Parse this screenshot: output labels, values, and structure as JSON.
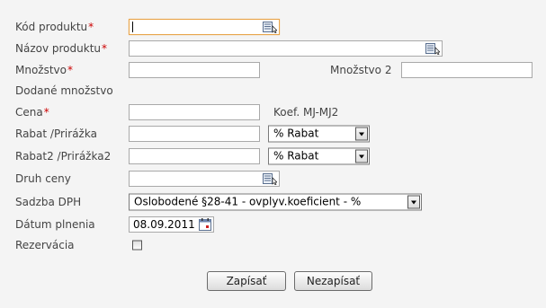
{
  "form": {
    "kod_produktu": {
      "label": "Kód produktu",
      "required_mark": "*",
      "value": ""
    },
    "nazov_produktu": {
      "label": "Názov produktu",
      "required_mark": "*",
      "value": ""
    },
    "mnozstvo": {
      "label": "Množstvo",
      "required_mark": "*",
      "value": ""
    },
    "mnozstvo2": {
      "label": "Množstvo 2",
      "value": ""
    },
    "dodane_mnozstvo": {
      "label": "Dodané množstvo"
    },
    "cena": {
      "label": "Cena",
      "required_mark": "*",
      "value": "",
      "side_label": "Koef. MJ-MJ2"
    },
    "rabat": {
      "label": "Rabat /Prirážka",
      "value": "",
      "select_value": "% Rabat"
    },
    "rabat2": {
      "label": "Rabat2 /Prirážka2",
      "value": "",
      "select_value": "% Rabat"
    },
    "druh_ceny": {
      "label": "Druh ceny",
      "value": ""
    },
    "sadzba_dph": {
      "label": "Sadzba DPH",
      "select_value": "Oslobodené §28-41 - ovplyv.koeficient - %"
    },
    "datum_plnenia": {
      "label": "Dátum plnenia",
      "value": "08.09.2011"
    },
    "rezervacia": {
      "label": "Rezervácia",
      "checked": false
    }
  },
  "buttons": {
    "save_label": "Zapísať",
    "cancel_label": "Nezapísať"
  },
  "icons": {
    "lookup": "list-lookup-icon",
    "calendar": "calendar-icon",
    "dropdown": "chevron-down-icon"
  },
  "colors": {
    "required": "#cc0000",
    "focus_border": "#e8a44a",
    "background": "#f4f4f4"
  }
}
